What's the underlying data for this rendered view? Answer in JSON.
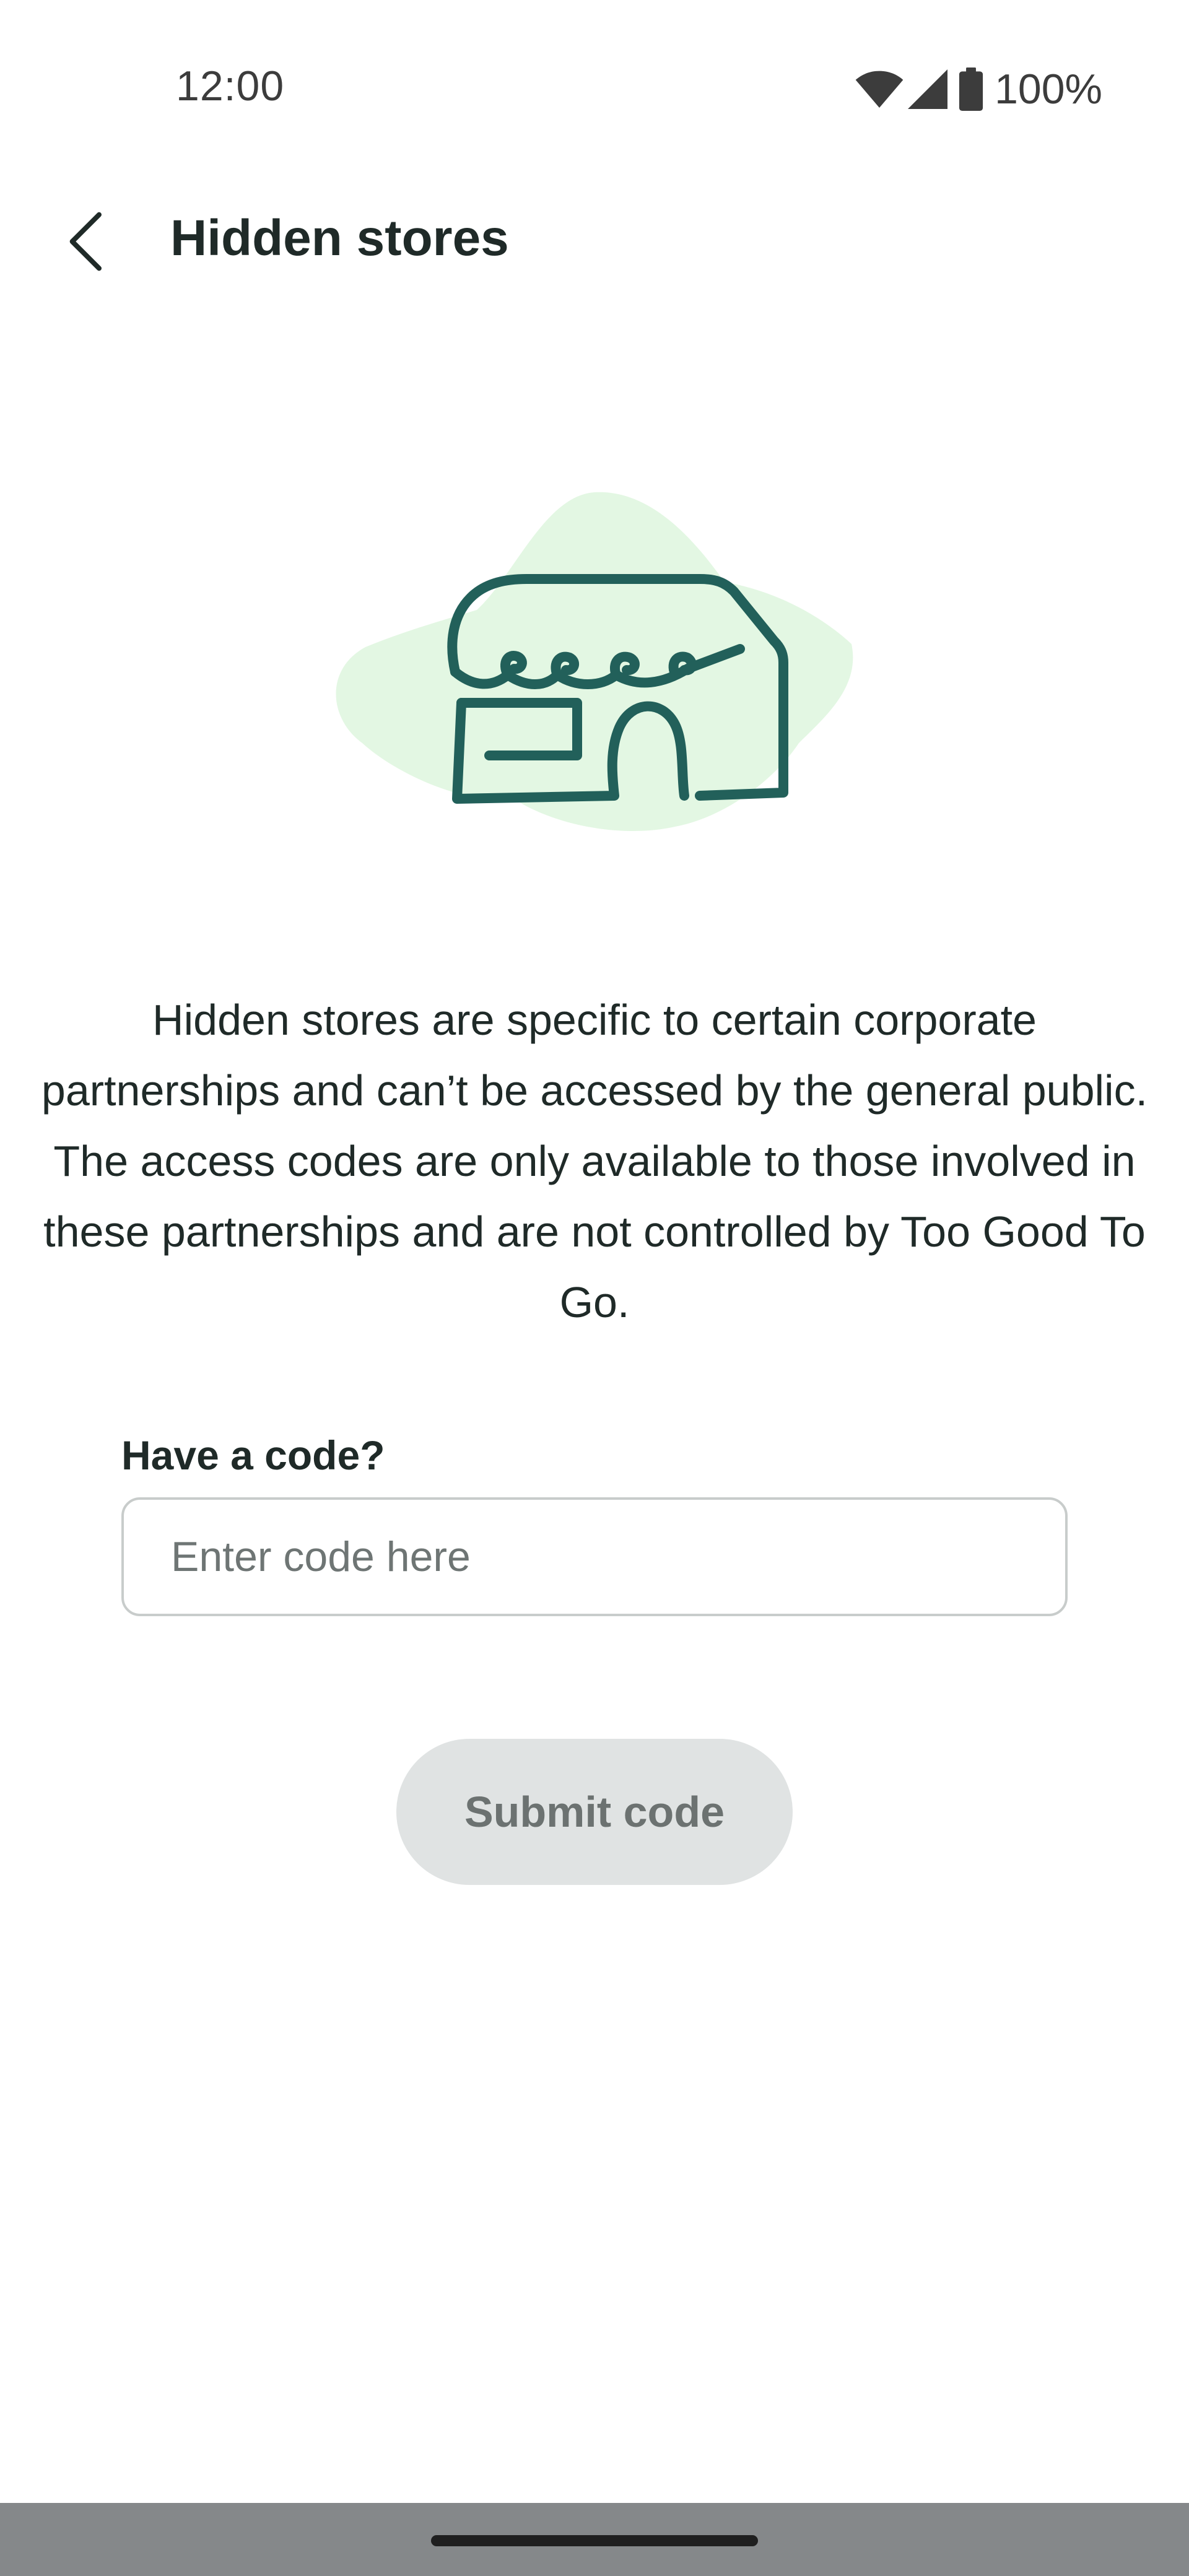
{
  "status_bar": {
    "time": "12:00",
    "battery_text": "100%",
    "icons": [
      "wifi-icon",
      "cellular-signal-icon",
      "battery-icon"
    ]
  },
  "app_bar": {
    "back_icon": "chevron-left-icon",
    "title": "Hidden stores"
  },
  "illustration": {
    "icon": "storefront-illustration",
    "blob_color": "#e3f7e3",
    "line_color": "#22605a"
  },
  "content": {
    "description": "Hidden stores are specific to certain corporate partnerships and can’t be accessed by the general public. The access codes are only available to those involved in these partnerships and are not controlled by Too Good To Go.",
    "code_label": "Have a code?",
    "code_input": {
      "value": "",
      "placeholder": "Enter code here"
    },
    "submit_label": "Submit code"
  },
  "colors": {
    "text_primary": "#1f2a28",
    "button_disabled_bg": "#e0e3e3",
    "button_disabled_text": "#6c7271",
    "nav_bar": "#85888a"
  }
}
